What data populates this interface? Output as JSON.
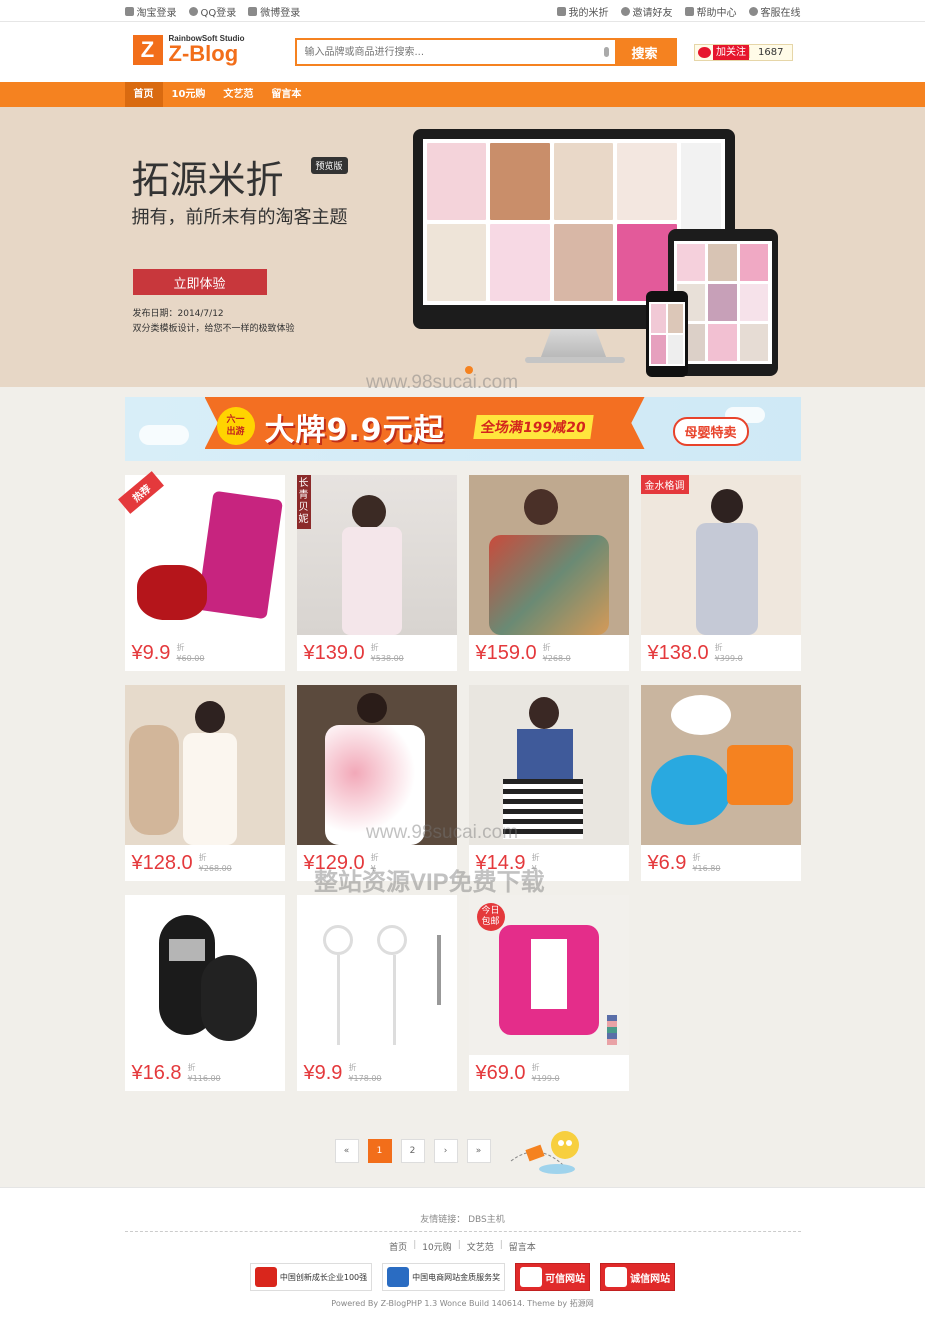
{
  "topbar": {
    "left": [
      {
        "label": "淘宝登录",
        "icon": "taobao-icon"
      },
      {
        "label": "QQ登录",
        "icon": "qq-icon"
      },
      {
        "label": "微博登录",
        "icon": "weibo-icon"
      }
    ],
    "right": [
      {
        "label": "我的米折",
        "icon": "user-icon"
      },
      {
        "label": "邀请好友",
        "icon": "friends-icon"
      },
      {
        "label": "帮助中心",
        "icon": "help-icon"
      },
      {
        "label": "客服在线",
        "icon": "service-icon"
      }
    ]
  },
  "header": {
    "logo_mark": "Z",
    "logo_sub": "RainbowSoft Studio",
    "logo_main": "Z-Blog",
    "search_placeholder": "输入品牌或商品进行搜索...",
    "search_button": "搜索",
    "follow_label": "加关注",
    "follow_count": "1687"
  },
  "nav": {
    "items": [
      "首页",
      "10元购",
      "文艺范",
      "留言本"
    ],
    "active_index": 0
  },
  "banner": {
    "title": "拓源米折",
    "badge": "预览版",
    "subtitle": "拥有，前所未有的淘客主题",
    "cta": "立即体验",
    "release_date": "发布日期：2014/7/12",
    "release_desc": "双分类模板设计，给您不一样的极致体验"
  },
  "promo": {
    "badge_top": "六一",
    "badge_bottom": "出游",
    "main": "大牌9.9元起",
    "sub": "全场满199减20",
    "mom": "母婴特卖"
  },
  "products": [
    {
      "price": "¥9.9",
      "discount": "折",
      "original": "¥60.00",
      "ribbon": "热荐",
      "ribbon_type": "diag",
      "art": "dates"
    },
    {
      "price": "¥139.0",
      "discount": "折",
      "original": "¥538.00",
      "ribbon": "长青贝妮",
      "ribbon_type": "vert",
      "art": "dress-white"
    },
    {
      "price": "¥159.0",
      "discount": "折",
      "original": "¥268.0",
      "ribbon": "",
      "ribbon_type": "",
      "art": "dress-floral"
    },
    {
      "price": "¥138.0",
      "discount": "折",
      "original": "¥399.0",
      "ribbon": "金水格调",
      "ribbon_type": "tag",
      "art": "dress-grey"
    },
    {
      "price": "¥128.0",
      "discount": "折",
      "original": "¥268.00",
      "ribbon": "",
      "ribbon_type": "",
      "art": "dress-cream"
    },
    {
      "price": "¥129.0",
      "discount": "折",
      "original": "¥",
      "ribbon": "",
      "ribbon_type": "",
      "art": "dress-pink"
    },
    {
      "price": "¥14.9",
      "discount": "折",
      "original": "¥",
      "ribbon": "",
      "ribbon_type": "",
      "art": "top-stripe"
    },
    {
      "price": "¥6.9",
      "discount": "折",
      "original": "¥16.80",
      "ribbon": "",
      "ribbon_type": "",
      "art": "ice-molds"
    },
    {
      "price": "¥16.8",
      "discount": "折",
      "original": "¥116.00",
      "ribbon": "",
      "ribbon_type": "",
      "art": "usb"
    },
    {
      "price": "¥9.9",
      "discount": "折",
      "original": "¥178.00",
      "ribbon": "",
      "ribbon_type": "",
      "art": "earphones"
    },
    {
      "price": "¥69.0",
      "discount": "折",
      "original": "¥199.0",
      "ribbon": "今日包邮",
      "ribbon_type": "today",
      "art": "cardigan"
    }
  ],
  "pagination": {
    "items": [
      "«",
      "1",
      "2",
      "›",
      "»"
    ],
    "active": "1"
  },
  "footer": {
    "friend_links": "友情链接：  DBS主机",
    "nav": [
      "首页",
      "10元购",
      "文艺范",
      "留言本"
    ],
    "badges": [
      {
        "label": "中国创新成长企业100强",
        "mark": "100"
      },
      {
        "label": "中国电商网站金质服务奖",
        "mark": "EC"
      },
      {
        "label": "可信网站",
        "mark": "可信"
      },
      {
        "label": "诚信网站",
        "mark": "信"
      }
    ],
    "powered": "Powered By Z-BlogPHP 1.3 Wonce Build 140614. Theme by 拓源网"
  },
  "watermarks": {
    "site": "www.98sucai.com",
    "text": "整站资源VIP免费下载"
  },
  "colors": {
    "accent": "#f58220",
    "price": "#e4393c",
    "banner_bg": "#e7d7c6"
  }
}
